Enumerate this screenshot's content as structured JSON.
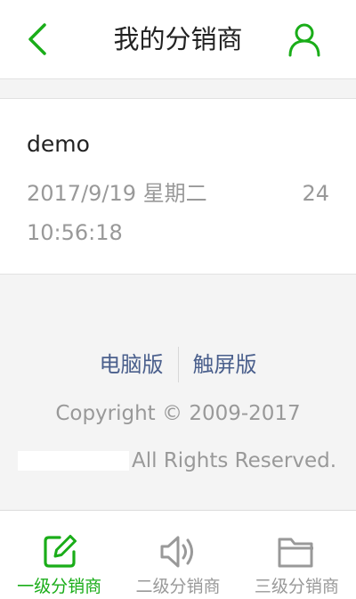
{
  "colors": {
    "accent": "#1aad19",
    "link": "#4a5f8c",
    "muted": "#999999"
  },
  "header": {
    "title": "我的分销商",
    "back_icon": "chevron-left-icon",
    "user_icon": "user-icon"
  },
  "distributor": {
    "name": "demo",
    "datetime": "2017/9/19 星期二 10:56:18",
    "count": "24"
  },
  "footer": {
    "links": [
      "电脑版",
      "触屏版"
    ],
    "copyright": "Copyright © 2009-2017",
    "rights": "All Rights Reserved."
  },
  "tabs": [
    {
      "label": "一级分销商",
      "icon": "edit-icon",
      "active": true
    },
    {
      "label": "二级分销商",
      "icon": "speaker-icon",
      "active": false
    },
    {
      "label": "三级分销商",
      "icon": "folder-icon",
      "active": false
    }
  ]
}
